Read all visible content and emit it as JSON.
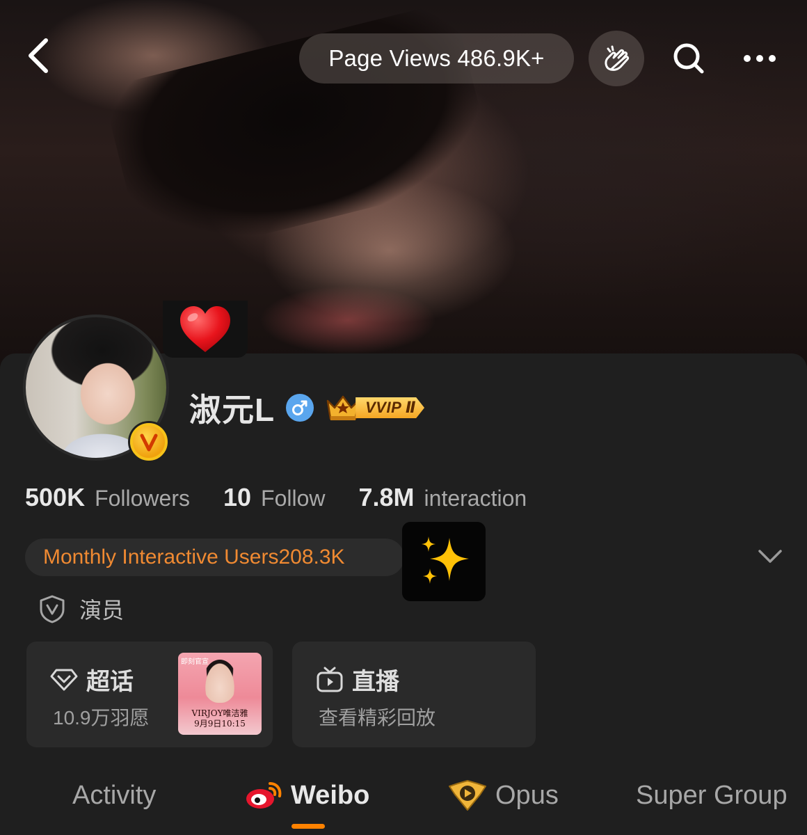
{
  "header": {
    "page_views": "Page Views 486.9K+",
    "icons": [
      "back-arrow-icon",
      "gesture-icon",
      "search-icon",
      "more-icon"
    ]
  },
  "profile": {
    "username": "淑元L",
    "gender": "male",
    "membership": "VVIP Ⅱ",
    "decorations": [
      "heart-emoji",
      "sparkles-emoji"
    ]
  },
  "stats": [
    {
      "value": "500K",
      "label": "Followers"
    },
    {
      "value": "10",
      "label": "Follow"
    },
    {
      "value": "7.8M",
      "label": "interaction"
    }
  ],
  "monthly": "Monthly Interactive Users208.3K",
  "role": "演员",
  "cards": {
    "supertopic": {
      "title": "超话",
      "subtitle": "10.9万羽愿"
    },
    "live": {
      "title": "直播",
      "subtitle": "查看精彩回放"
    },
    "poster": {
      "tag": "即刻官宣",
      "line1": "VIRJOY唯洁雅",
      "line2": "9月9日10:15"
    }
  },
  "tabs": [
    {
      "label": "Activity",
      "active": false
    },
    {
      "label": "Weibo",
      "active": true
    },
    {
      "label": "Opus",
      "active": false
    },
    {
      "label": "Super Group",
      "active": false
    }
  ],
  "colors": {
    "accent": "#ff8200",
    "monthly_text": "#f08a32",
    "panel_bg": "#1f1f1f",
    "card_bg": "#2a2a2a"
  }
}
